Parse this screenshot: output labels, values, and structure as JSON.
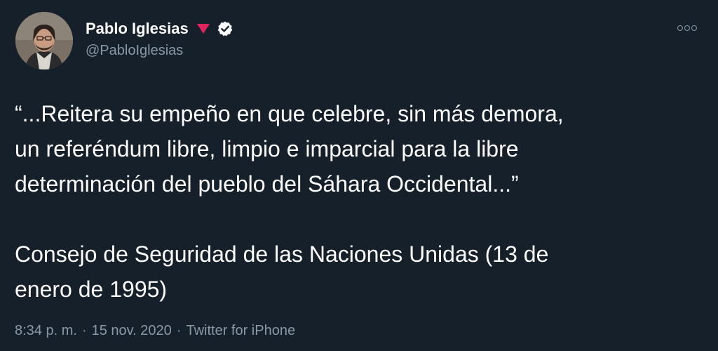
{
  "author": {
    "display_name": "Pablo Iglesias",
    "handle": "@PabloIglesias"
  },
  "icons": {
    "flag": "red-triangle-flag-icon",
    "verified": "verified-badge-icon",
    "more": "more-options-icon"
  },
  "colors": {
    "background": "#15202b",
    "text": "#ffffff",
    "secondary_text": "#8b98a5",
    "flag": "#e0245e"
  },
  "tweet": {
    "lines": [
      "“...Reitera su empeño en que celebre, sin más demora,",
      "un referéndum libre, limpio e imparcial para la libre",
      "determinación del pueblo del Sáhara Occidental...”"
    ],
    "source_lines": [
      "Consejo de Seguridad de las Naciones Unidas (13 de",
      "enero de 1995)"
    ]
  },
  "meta": {
    "time": "8:34 p. m.",
    "separator": "·",
    "date": "15 nov. 2020",
    "client": "Twitter for iPhone"
  }
}
